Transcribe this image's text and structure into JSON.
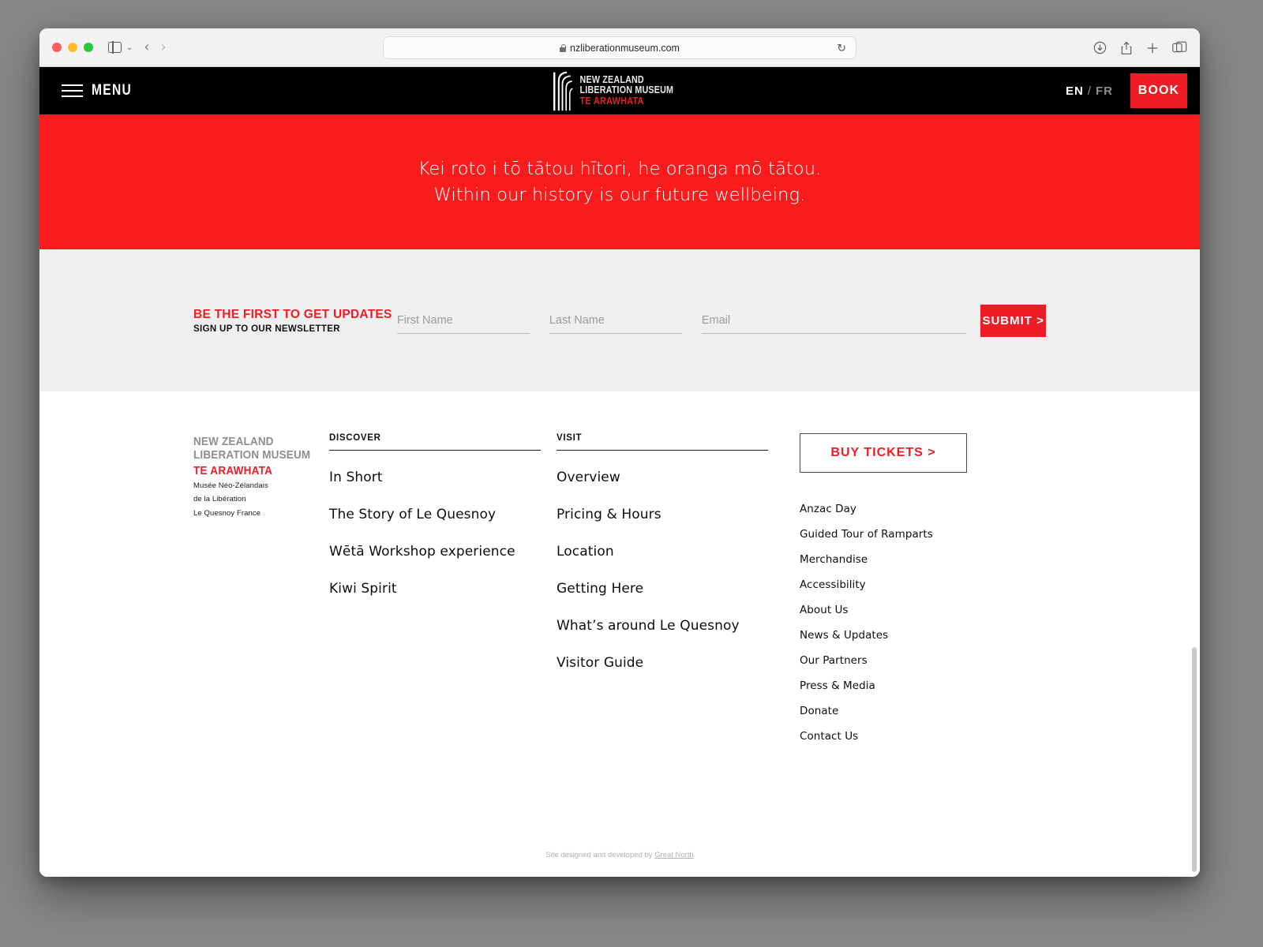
{
  "browser": {
    "url": "nzliberationmuseum.com",
    "lock_icon": "lock-icon",
    "reload_icon": "↻",
    "back_icon": "‹",
    "forward_icon": "›",
    "sidebar_icon": "sidebar-icon",
    "tabs_overview_icon": "tabs-icon",
    "download_icon": "download-icon",
    "share_icon": "share-icon",
    "new_tab_icon": "plus-icon"
  },
  "header": {
    "menu_label": "MENU",
    "brand": {
      "line1": "NEW ZEALAND",
      "line2": "LIBERATION MUSEUM",
      "line3": "TE ARAWHATA"
    },
    "lang": {
      "en": "EN",
      "separator": "/",
      "fr": "FR"
    },
    "book_label": "BOOK"
  },
  "hero": {
    "line_maori": "Kei roto i tō tātou hītori, he oranga mō tātou.",
    "line_english": "Within our history is our future wellbeing."
  },
  "newsletter": {
    "title": "BE THE FIRST TO GET UPDATES",
    "subtitle": "SIGN UP TO OUR NEWSLETTER",
    "first_name_placeholder": "First Name",
    "first_name_value": "",
    "last_name_placeholder": "Last Name",
    "last_name_value": "",
    "email_placeholder": "Email",
    "email_value": "",
    "submit_label": "SUBMIT >"
  },
  "footer": {
    "logo": {
      "line1": "NEW ZEALAND",
      "line2": "LIBERATION MUSEUM",
      "line3": "TE ARAWHATA",
      "fr1": "Musée Néo-Zélandais",
      "fr2": "de la Libération",
      "fr3": "Le Quesnoy France"
    },
    "discover": {
      "heading": "DISCOVER",
      "items": [
        "In Short",
        "The Story of Le Quesnoy",
        "Wētā Workshop experience",
        "Kiwi Spirit"
      ]
    },
    "visit": {
      "heading": "VISIT",
      "items": [
        "Overview",
        "Pricing & Hours",
        "Location",
        "Getting Here",
        "What’s around Le Quesnoy",
        "Visitor Guide"
      ]
    },
    "tickets_label": "BUY TICKETS >",
    "quick_links": [
      "Anzac Day",
      "Guided Tour of Ramparts",
      "Merchandise",
      "Accessibility",
      "About Us",
      "News & Updates",
      "Our Partners",
      "Press & Media",
      "Donate",
      "Contact Us"
    ],
    "credit_prefix": "Site designed and developed by ",
    "credit_link": "Great North"
  },
  "colors": {
    "brand_red": "#ee1c25",
    "hero_red": "#fa1c1c",
    "header_black": "#000000",
    "newsletter_grey": "#efefef"
  }
}
